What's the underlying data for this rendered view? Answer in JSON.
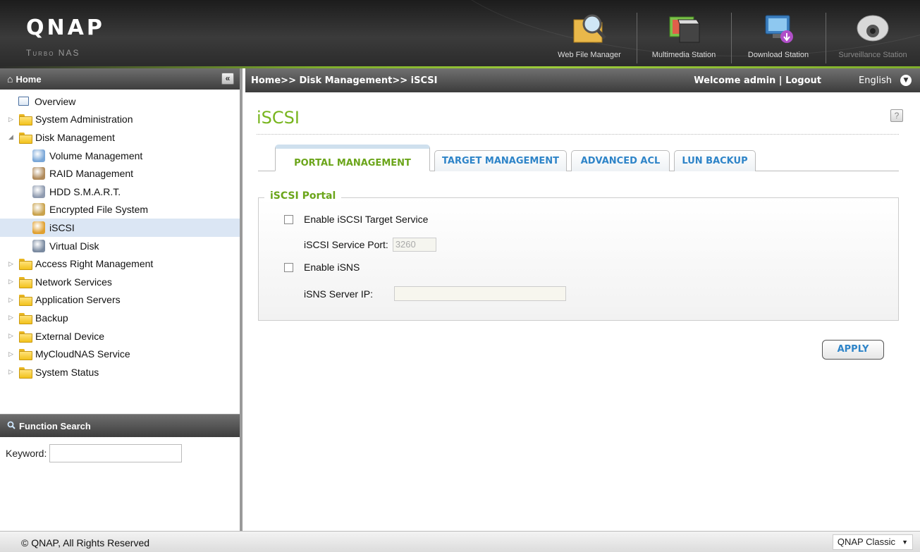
{
  "header": {
    "logo": "QNAP",
    "logo_sub": "Turbo NAS",
    "apps": [
      {
        "label": "Web File Manager",
        "icon": "magnifier-folder-icon"
      },
      {
        "label": "Multimedia Station",
        "icon": "multimedia-icon"
      },
      {
        "label": "Download Station",
        "icon": "download-icon"
      },
      {
        "label": "Surveillance Station",
        "icon": "camera-icon"
      }
    ]
  },
  "sidebar": {
    "home_label": "Home",
    "collapse_label": "«",
    "tree": [
      {
        "label": "Overview",
        "level": "top-plain",
        "icon": "overview-icon"
      },
      {
        "label": "System Administration",
        "level": "top",
        "expanded": false
      },
      {
        "label": "Disk Management",
        "level": "top",
        "expanded": true
      },
      {
        "label": "Volume Management",
        "level": "child",
        "icon": "volume-icon",
        "color": "#7aa7d8"
      },
      {
        "label": "RAID Management",
        "level": "child",
        "icon": "raid-icon",
        "color": "#b08a5a"
      },
      {
        "label": "HDD S.M.A.R.T.",
        "level": "child",
        "icon": "hdd-smart-icon",
        "color": "#8f9bb0"
      },
      {
        "label": "Encrypted File System",
        "level": "child",
        "icon": "encrypted-fs-icon",
        "color": "#c9a24c"
      },
      {
        "label": "iSCSI",
        "level": "child",
        "icon": "iscsi-icon",
        "color": "#e0a030",
        "selected": true
      },
      {
        "label": "Virtual Disk",
        "level": "child",
        "icon": "virtual-disk-icon",
        "color": "#7a8aa0"
      },
      {
        "label": "Access Right Management",
        "level": "top",
        "expanded": false
      },
      {
        "label": "Network Services",
        "level": "top",
        "expanded": false
      },
      {
        "label": "Application Servers",
        "level": "top",
        "expanded": false
      },
      {
        "label": "Backup",
        "level": "top",
        "expanded": false
      },
      {
        "label": "External Device",
        "level": "top",
        "expanded": false
      },
      {
        "label": "MyCloudNAS Service",
        "level": "top",
        "expanded": false
      },
      {
        "label": "System Status",
        "level": "top",
        "expanded": false
      }
    ],
    "search": {
      "title": "Function Search",
      "keyword_label": "Keyword:",
      "keyword_value": ""
    }
  },
  "main": {
    "breadcrumb": "Home>> Disk Management>> iSCSI",
    "welcome": "Welcome admin | Logout",
    "language": "English",
    "title": "iSCSI",
    "help": "?",
    "tabs": [
      {
        "label": "PORTAL MANAGEMENT",
        "active": true
      },
      {
        "label": "TARGET MANAGEMENT",
        "active": false
      },
      {
        "label": "ADVANCED ACL",
        "active": false
      },
      {
        "label": "LUN BACKUP",
        "active": false
      }
    ],
    "portal": {
      "legend": "iSCSI Portal",
      "enable_target_label": "Enable iSCSI Target Service",
      "port_label": "iSCSI Service Port:",
      "port_value": "3260",
      "enable_isns_label": "Enable iSNS",
      "isns_ip_label": "iSNS Server IP:",
      "isns_ip_value": ""
    },
    "apply_label": "APPLY"
  },
  "footer": {
    "copyright": "© QNAP, All Rights Reserved",
    "theme": "QNAP Classic"
  }
}
